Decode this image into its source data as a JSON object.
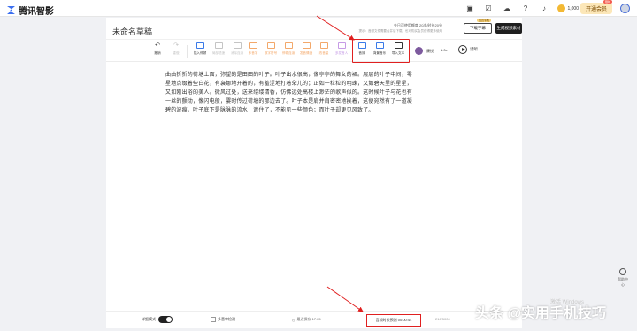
{
  "app": {
    "name": "腾讯智影"
  },
  "topbar": {
    "coin_value": "1,000",
    "vip_label": "开通会员",
    "vip_badge": "限时"
  },
  "editor": {
    "doc_title": "未命名草稿",
    "quota": "今日可使用额度 20次/时长20分",
    "hint": "提示：音频文件需要合并后下载。也可购买会员获得更多使用",
    "member_tag": "会员专属",
    "download_subtitle": "下载字幕",
    "generate": "生成视频素材"
  },
  "toolbar": {
    "undo": "撤销",
    "redo": "重做",
    "insert_pause": "插入停顿",
    "local_speed": "局部语速",
    "silence": "消除连读",
    "polyphone": "多音字",
    "number_symbol": "数字符号",
    "continuous": "停顿连读",
    "emotion": "发音情绪",
    "volume": "改音量",
    "multi_speaker": "多发音人",
    "sound_effect": "音效",
    "bg_music": "背景音乐",
    "import_text": "导入文本",
    "voice_name": "康悦",
    "speed": "1.0x",
    "trial": "试听"
  },
  "content": {
    "text": "曲曲折折的荷塘上面，弥望的是田田的叶子。叶子出水很高，像亭亭的舞女的裙。层层的叶子中间，零星地点缀着些白花，有袅娜地开着的，有羞涩地打着朵儿的；正如一粒粒的明珠，又如碧天里的星星，又如刚出浴的美人。微风过处，送来缕缕清香，仿佛远处高楼上渺茫的歌声似的。这时候叶子与花也有一丝的颤动，像闪电般，霎时传过荷塘的那边去了。叶子本是肩并肩密密地挨着，这便宛然有了一道凝碧的波痕。叶子底下是脉脉的流水，遮住了，不能见一些颜色；而叶子却更见风致了。"
  },
  "footer": {
    "detail_mode": "详细模式",
    "polyphone_check": "多音字检测",
    "autosave": "最近保存 17:05",
    "duration": "音频时长预测 00:00:44",
    "char_count": "216/5000"
  },
  "help": {
    "label": "帮助中心"
  },
  "overlay": {
    "watermark": "头条 @实用手机技巧",
    "windows_mark": "激活 Windows"
  }
}
